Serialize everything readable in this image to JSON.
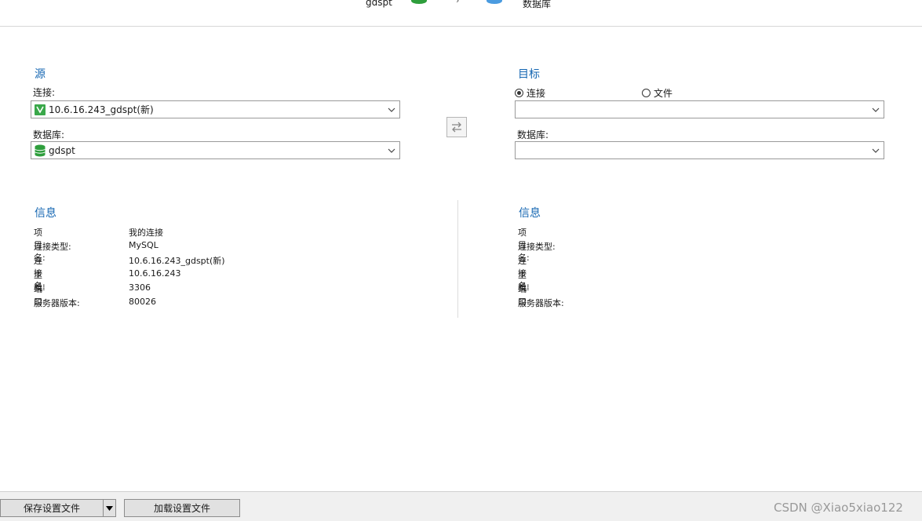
{
  "header": {
    "source_db_name": "gdspt",
    "target_type": "数据库"
  },
  "source": {
    "title": "源",
    "connection_label": "连接:",
    "connection_value": "10.6.16.243_gdspt(新)",
    "database_label": "数据库:",
    "database_value": "gdspt"
  },
  "target": {
    "title": "目标",
    "radio_connection": "连接",
    "radio_file": "文件",
    "database_label": "数据库:",
    "connection_value": "",
    "database_value": ""
  },
  "source_info": {
    "title": "信息",
    "rows": [
      {
        "key": "项目名:",
        "value": "我的连接"
      },
      {
        "key": "连接类型:",
        "value": "MySQL"
      },
      {
        "key": "连接名:",
        "value": "10.6.16.243_gdspt(新)"
      },
      {
        "key": "主机:",
        "value": "10.6.16.243"
      },
      {
        "key": "端口:",
        "value": "3306"
      },
      {
        "key": "服务器版本:",
        "value": "80026"
      }
    ]
  },
  "target_info": {
    "title": "信息",
    "rows": [
      {
        "key": "项目名:",
        "value": ""
      },
      {
        "key": "连接类型:",
        "value": ""
      },
      {
        "key": "连接名:",
        "value": ""
      },
      {
        "key": "主机:",
        "value": ""
      },
      {
        "key": "端口:",
        "value": ""
      },
      {
        "key": "服务器版本:",
        "value": ""
      }
    ]
  },
  "footer": {
    "save_label": "保存设置文件",
    "load_label": "加载设置文件",
    "watermark": "CSDN @Xiao5xiao122"
  },
  "icons": {
    "connection": "mysql-connection-icon",
    "database": "database-icon",
    "swap": "swap-icon",
    "dropdown": "chevron-down-icon"
  },
  "colors": {
    "section_title": "#1466b2",
    "db_green": "#2e9e3c",
    "db_blue": "#4a9be0"
  }
}
